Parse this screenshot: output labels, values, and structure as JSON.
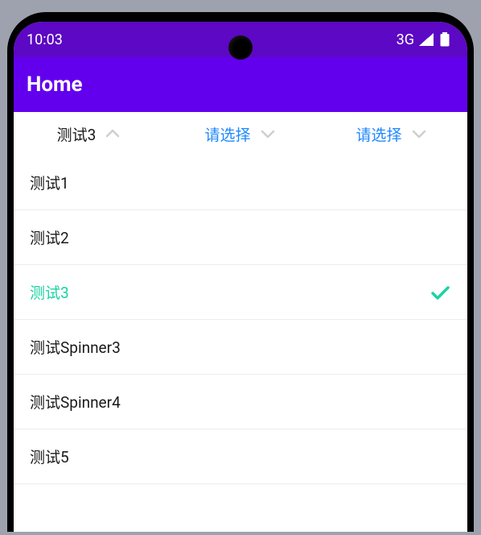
{
  "status": {
    "time": "10:03",
    "network": "3G"
  },
  "appbar": {
    "title": "Home"
  },
  "filters": [
    {
      "label": "测试3",
      "state": "open",
      "color": "dark"
    },
    {
      "label": "请选择",
      "state": "closed",
      "color": "blue"
    },
    {
      "label": "请选择",
      "state": "closed",
      "color": "blue"
    }
  ],
  "list": {
    "items": [
      {
        "label": "测试1",
        "selected": false
      },
      {
        "label": "测试2",
        "selected": false
      },
      {
        "label": "测试3",
        "selected": true
      },
      {
        "label": "测试Spinner3",
        "selected": false
      },
      {
        "label": "测试Spinner4",
        "selected": false
      },
      {
        "label": "测试5",
        "selected": false
      }
    ]
  },
  "colors": {
    "statusbar": "#5c08c4",
    "appbar": "#6200ee",
    "accent_blue": "#1e88ff",
    "accent_green": "#1ad3a3"
  }
}
